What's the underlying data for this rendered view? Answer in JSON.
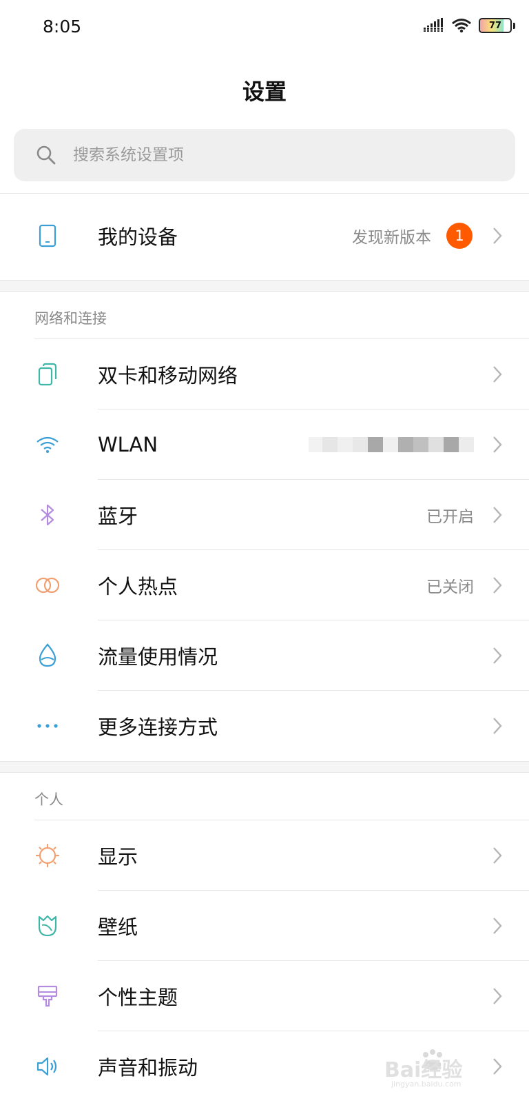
{
  "status_bar": {
    "time": "8:05",
    "battery_level": "77",
    "battery_fraction": 0.77,
    "icons": [
      "signal-icon",
      "wifi-icon",
      "battery-icon"
    ]
  },
  "header": {
    "title": "设置"
  },
  "search": {
    "placeholder": "搜索系统设置项"
  },
  "my_device": {
    "label": "我的设备",
    "value": "发现新版本",
    "badge": "1",
    "icon": "phone-icon"
  },
  "sections": {
    "network": {
      "header": "网络和连接",
      "items": [
        {
          "label": "双卡和移动网络",
          "value": "",
          "icon": "sim-cards-icon"
        },
        {
          "label": "WLAN",
          "value": "",
          "icon": "wifi-icon"
        },
        {
          "label": "蓝牙",
          "value": "已开启",
          "icon": "bluetooth-icon"
        },
        {
          "label": "个人热点",
          "value": "已关闭",
          "icon": "hotspot-icon"
        },
        {
          "label": "流量使用情况",
          "value": "",
          "icon": "data-usage-icon"
        },
        {
          "label": "更多连接方式",
          "value": "",
          "icon": "more-dots-icon"
        }
      ]
    },
    "personal": {
      "header": "个人",
      "items": [
        {
          "label": "显示",
          "value": "",
          "icon": "display-sun-icon"
        },
        {
          "label": "壁纸",
          "value": "",
          "icon": "wallpaper-tulip-icon"
        },
        {
          "label": "个性主题",
          "value": "",
          "icon": "theme-brush-icon"
        },
        {
          "label": "声音和振动",
          "value": "",
          "icon": "speaker-icon"
        }
      ]
    }
  },
  "colors": {
    "badge": "#ff5a00",
    "teal": "#3fb6a8",
    "blue": "#3a9fd6",
    "purple": "#b38ce0",
    "orange": "#f0a070",
    "secondary_text": "#8a8a8a",
    "search_bg": "#efefef"
  },
  "watermark": {
    "text": "Bai经验",
    "sub": "jingyan.baidu.com"
  }
}
